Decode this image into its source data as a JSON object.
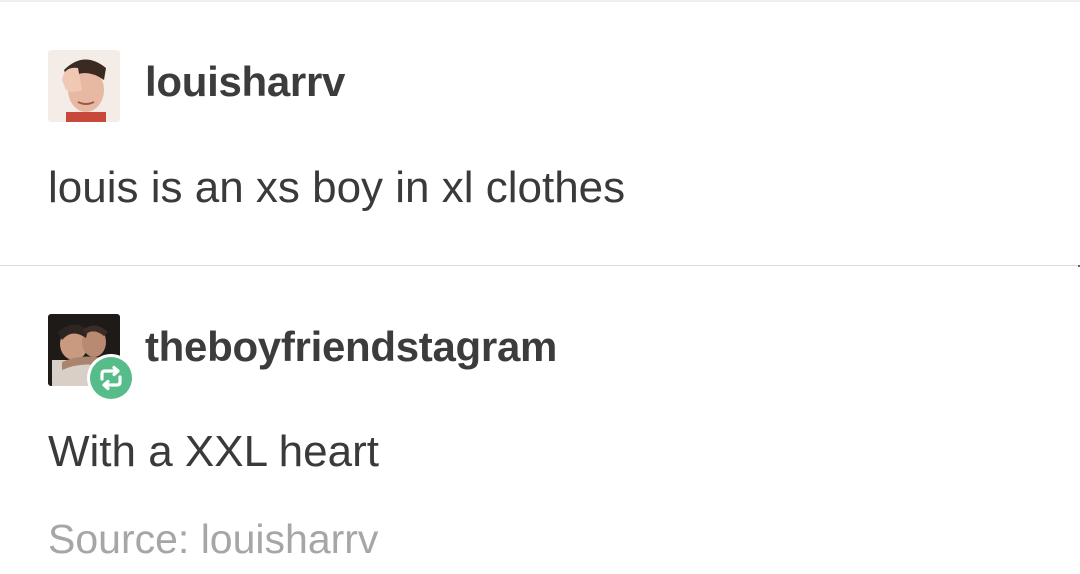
{
  "posts": [
    {
      "username": "louisharrv",
      "text": "louis is an xs boy in xl clothes"
    },
    {
      "username": "theboyfriendstagram",
      "text": "With a XXL heart",
      "source_label": "Source: louisharrv",
      "reblog_icon": "reblog-icon",
      "reblog_color": "#56bc8a"
    }
  ]
}
